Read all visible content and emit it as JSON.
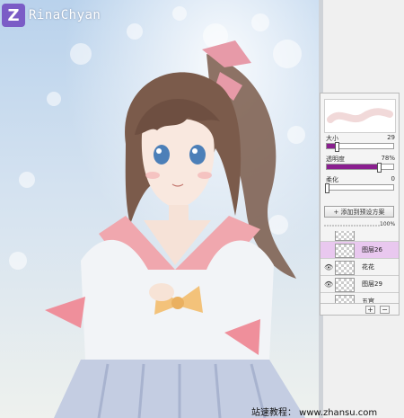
{
  "brand": {
    "logo_letter": "Z",
    "name": "RinaChyan"
  },
  "brush_panel": {
    "size": {
      "label": "大小",
      "value": "29",
      "level": 0.15
    },
    "opacity": {
      "label": "透明度",
      "value": "78%",
      "level": 0.78
    },
    "soften": {
      "label": "柔化",
      "value": "0",
      "level": 0.0
    },
    "add_preset_label": "+ 添加到预设方案",
    "layer_opacity_value": "100%"
  },
  "layers": [
    {
      "name": "",
      "visible": false,
      "selected": false
    },
    {
      "name": "图层26",
      "visible": false,
      "selected": true
    },
    {
      "name": "花花",
      "visible": true,
      "selected": false
    },
    {
      "name": "图层29",
      "visible": true,
      "selected": false
    },
    {
      "name": "五官",
      "visible": false,
      "selected": false
    }
  ],
  "footer_buttons": {
    "add": "+",
    "remove": "−"
  },
  "watermark": "站速教程： www.zhansu.com",
  "colors": {
    "accent": "#8a1f8f",
    "selected_layer": "#e9c8ef",
    "logo": "#7b5cc6"
  }
}
